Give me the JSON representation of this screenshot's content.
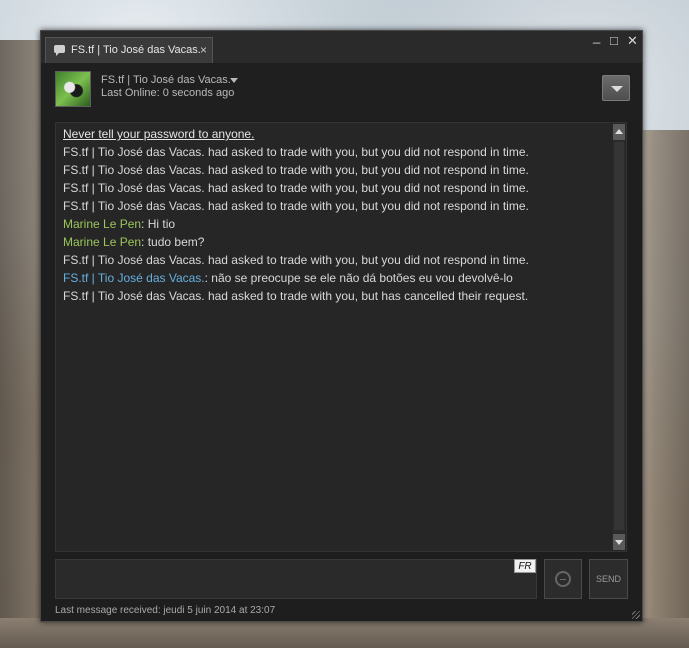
{
  "window": {
    "tab_label": "FS.tf | Tio José das Vacas.",
    "tab_close": "×",
    "controls": {
      "minimize": "_",
      "maximize": "□",
      "close": "✕"
    }
  },
  "header": {
    "name": "FS.tf | Tio José das Vacas.",
    "status": "Last Online: 0 seconds ago",
    "avatar_icon": "avatar-image",
    "dropdown_icon": "chevron-down-icon"
  },
  "messages": [
    {
      "type": "warning",
      "text": "Never tell your password to anyone."
    },
    {
      "type": "system",
      "text": "FS.tf | Tio José das Vacas. had asked to trade with you, but you did not respond in time."
    },
    {
      "type": "system",
      "text": "FS.tf | Tio José das Vacas. had asked to trade with you, but you did not respond in time."
    },
    {
      "type": "system",
      "text": "FS.tf | Tio José das Vacas. had asked to trade with you, but you did not respond in time."
    },
    {
      "type": "system",
      "text": "FS.tf | Tio José das Vacas. had asked to trade with you, but you did not respond in time."
    },
    {
      "type": "chat",
      "sender": "Marine Le Pen",
      "sep": ": ",
      "text": "Hi tio",
      "color": "green"
    },
    {
      "type": "chat",
      "sender": "Marine Le Pen",
      "sep": ": ",
      "text": "tudo bem?",
      "color": "green"
    },
    {
      "type": "system",
      "text": "FS.tf | Tio José das Vacas. had asked to trade with you, but you did not respond in time."
    },
    {
      "type": "chat",
      "sender": "FS.tf | Tio José das Vacas.",
      "sep": ": ",
      "text": "não se preocupe se ele não dá botões eu vou devolvê-lo",
      "color": "blue"
    },
    {
      "type": "system",
      "text": "FS.tf | Tio José das Vacas. had asked to trade with you, but has cancelled their request."
    }
  ],
  "input": {
    "lang": "FR",
    "value": ""
  },
  "send_label": "SEND",
  "footer": "Last message received: jeudi 5 juin 2014 at 23:07",
  "colors": {
    "green": "#9ac65a",
    "blue": "#66b0e0",
    "text": "#d8d8d8"
  }
}
